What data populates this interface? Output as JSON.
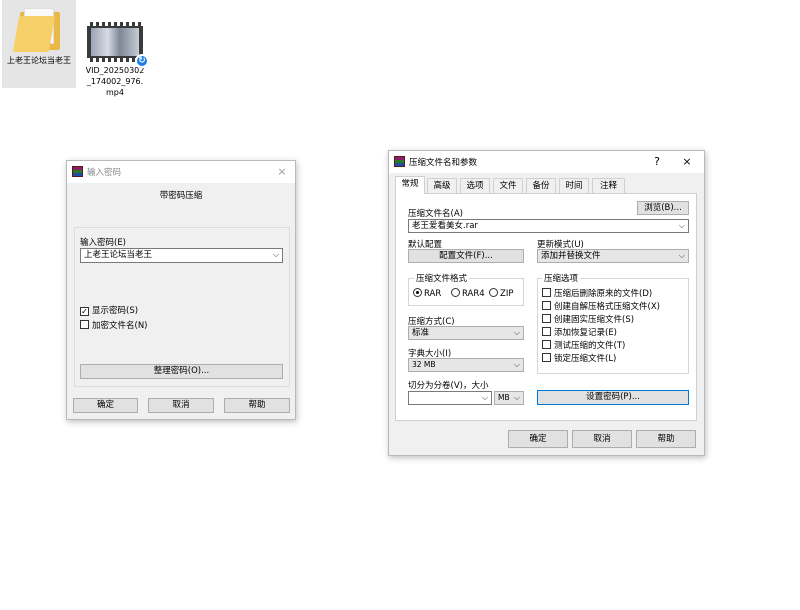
{
  "desktop": {
    "folder": {
      "label": "上老王论坛当老王"
    },
    "video": {
      "label": "VID_20250302_174002_976.mp4"
    }
  },
  "password_dialog": {
    "title": "输入密码",
    "close_icon": "×",
    "heading": "带密码压缩",
    "field_label": "输入密码(E)",
    "password_value": "上老王论坛当老王",
    "show_password_label": "显示密码(S)",
    "show_password_checked": true,
    "encrypt_names_label": "加密文件名(N)",
    "encrypt_names_checked": false,
    "organize_button": "整理密码(O)...",
    "ok_button": "确定",
    "cancel_button": "取消",
    "help_button": "帮助"
  },
  "archive_dialog": {
    "title": "压缩文件名和参数",
    "help_icon": "?",
    "close_icon": "×",
    "tabs": [
      "常规",
      "高级",
      "选项",
      "文件",
      "备份",
      "时间",
      "注释"
    ],
    "active_tab": "常规",
    "archive_name_label": "压缩文件名(A)",
    "archive_name_value": "老王爱看美女.rar",
    "browse_button": "浏览(B)...",
    "default_profile_label": "默认配置",
    "profiles_button": "配置文件(F)...",
    "update_mode_label": "更新模式(U)",
    "update_mode_value": "添加并替换文件",
    "format_group": "压缩文件格式",
    "format_options": [
      "RAR",
      "RAR4",
      "ZIP"
    ],
    "format_selected": "RAR",
    "method_label": "压缩方式(C)",
    "method_value": "标准",
    "dict_label": "字典大小(I)",
    "dict_value": "32 MB",
    "split_label": "切分为分卷(V)，大小",
    "split_value": "",
    "split_unit": "MB",
    "options_group": "压缩选项",
    "options": [
      "压缩后删除原来的文件(D)",
      "创建自解压格式压缩文件(X)",
      "创建固实压缩文件(S)",
      "添加恢复记录(E)",
      "测试压缩的文件(T)",
      "锁定压缩文件(L)"
    ],
    "set_password_button": "设置密码(P)...",
    "ok_button": "确定",
    "cancel_button": "取消",
    "help_button": "帮助"
  }
}
